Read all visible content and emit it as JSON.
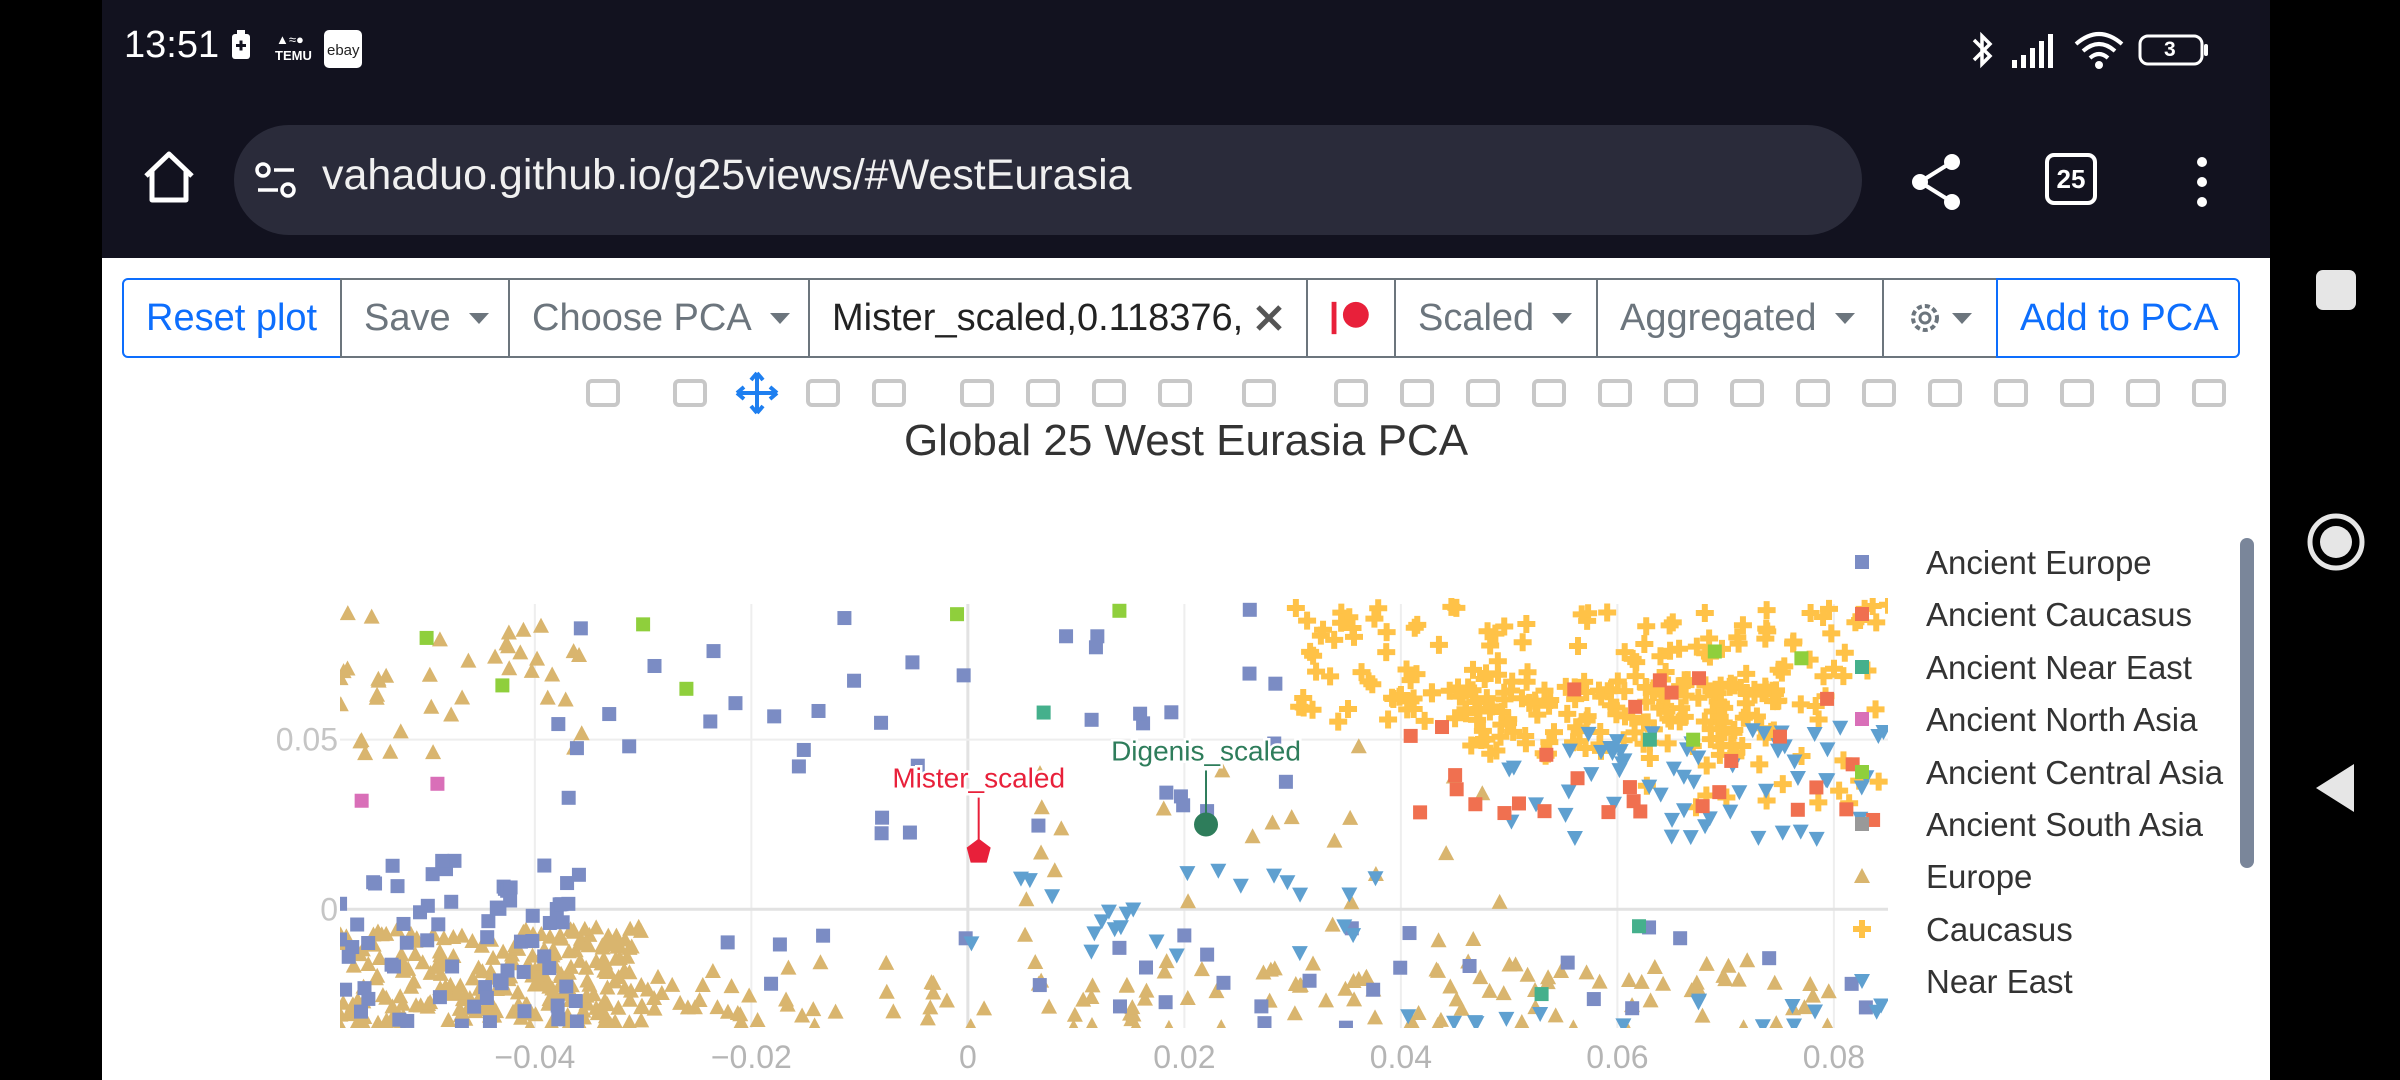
{
  "status_bar": {
    "time": "13:51",
    "battery": "3",
    "icons": [
      "battery-saver-icon",
      "temu-icon",
      "ebay-icon",
      "bluetooth-icon",
      "signal-icon",
      "wifi-icon",
      "battery-icon"
    ]
  },
  "browser": {
    "url": "vahaduo.github.io/g25views/#WestEurasia",
    "tab_count": "25"
  },
  "toolbar": {
    "reset": "Reset plot",
    "save": "Save",
    "choose_pca": "Choose PCA",
    "pca_input": "Mister_scaled,0.118376,",
    "scaled": "Scaled",
    "aggregated": "Aggregated",
    "add_to_pca": "Add to PCA"
  },
  "chart_data": {
    "type": "scatter",
    "title": "Global 25 West Eurasia PCA",
    "x_ticks": [
      "−0.04",
      "−0.02",
      "0",
      "0.02",
      "0.04",
      "0.06",
      "0.08"
    ],
    "y_ticks": [
      "0.05",
      "0"
    ],
    "xlim": [
      -0.058,
      0.085
    ],
    "ylim": [
      -0.035,
      0.09
    ],
    "grid": true,
    "legend_position": "right",
    "series": [
      {
        "name": "Ancient Europe",
        "color": "#7b8cc4",
        "marker": "square"
      },
      {
        "name": "Ancient Caucasus",
        "color": "#f07050",
        "marker": "square"
      },
      {
        "name": "Ancient Near East",
        "color": "#45b08c",
        "marker": "square"
      },
      {
        "name": "Ancient North Asia",
        "color": "#d96fb8",
        "marker": "square"
      },
      {
        "name": "Ancient Central Asia",
        "color": "#8fcf3c",
        "marker": "square"
      },
      {
        "name": "Ancient South Asia",
        "color": "#999999",
        "marker": "square"
      },
      {
        "name": "Europe",
        "color": "#d9b56e",
        "marker": "triangle-up"
      },
      {
        "name": "Caucasus",
        "color": "#ffc247",
        "marker": "cross"
      },
      {
        "name": "Near East",
        "color": "#5fa0d0",
        "marker": "triangle-down"
      }
    ],
    "annotations": [
      {
        "label": "Mister_scaled",
        "x": 0.001,
        "y": 0.017,
        "color": "#e8203a"
      },
      {
        "label": "Digenis_scaled",
        "x": 0.022,
        "y": 0.025,
        "color": "#2e7d5b"
      }
    ]
  }
}
